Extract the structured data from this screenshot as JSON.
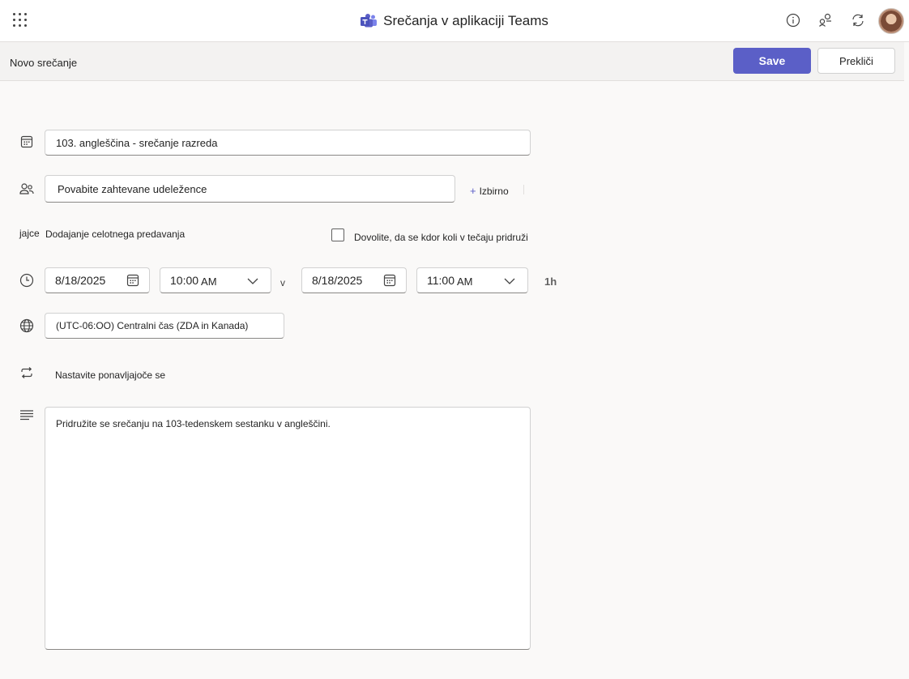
{
  "app": {
    "title": "Srečanja v aplikaciji Teams",
    "icons": [
      "waffle-icon",
      "info-icon",
      "share-icon",
      "refresh-icon",
      "avatar"
    ]
  },
  "command_bar": {
    "title": "Novo srečanje",
    "save_label": "Save",
    "cancel_label": "Prekliči"
  },
  "form": {
    "title_value": "103. angleščina - srečanje razreda",
    "attendees_placeholder": "Povabite zahtevane udeležence",
    "optional_label": "Izbirno",
    "optional_plus": "+",
    "channel_prefix": "jajce",
    "channel_label": "Dodajanje celotnega predavanja",
    "allow_anyone_label": "Dovolite, da se kdor koli v tečaju pridruži",
    "start_date": "8/18/2025",
    "start_time": "10:00",
    "start_ampm": "AM",
    "separator": "v",
    "end_date": "8/18/2025",
    "end_time": "11:00",
    "end_ampm": "AM",
    "duration": "1h",
    "timezone": "(UTC-06:OO) Centralni čas (ZDA in Kanada)",
    "repeat_label": "Nastavite ponavljajoče se",
    "description": "Pridružite se srečanju na 103-tedenskem sestanku v angleščini."
  },
  "colors": {
    "accent": "#5b5fc7",
    "background": "#faf9f8",
    "command_bar": "#f3f2f1"
  }
}
